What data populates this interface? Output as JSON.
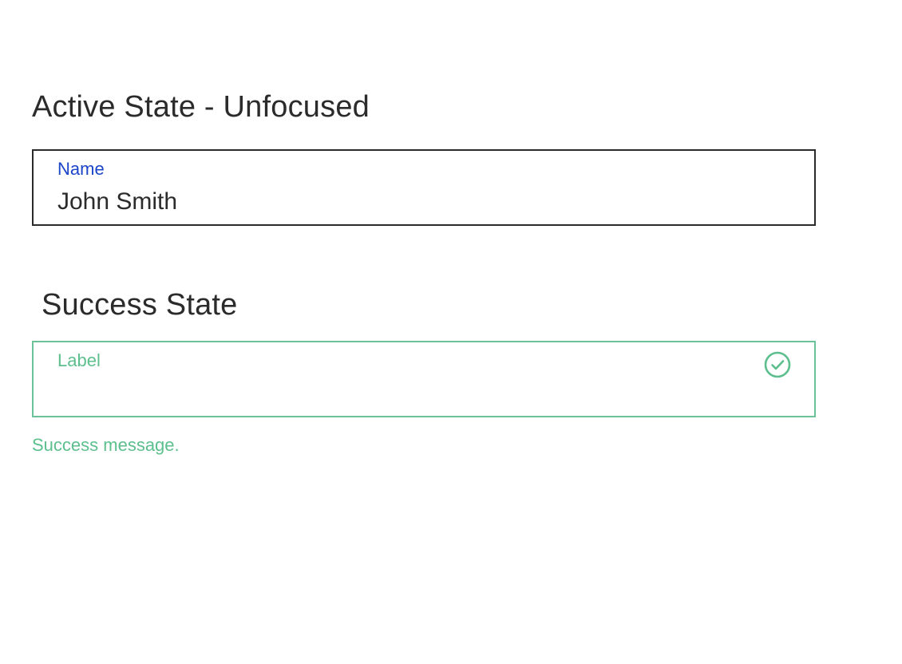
{
  "sections": {
    "active": {
      "title": "Active State - Unfocused",
      "field": {
        "label": "Name",
        "value": "John Smith"
      }
    },
    "success": {
      "title": "Success State",
      "field": {
        "label": "Label",
        "value": "",
        "icon": "check-circle-icon"
      },
      "helper_text": "Success message."
    }
  },
  "colors": {
    "text": "#2b2b2b",
    "active_label": "#1b45c9",
    "active_border": "#2b2b2b",
    "success": "#5cbf8d",
    "success_border": "#6cc39a"
  }
}
